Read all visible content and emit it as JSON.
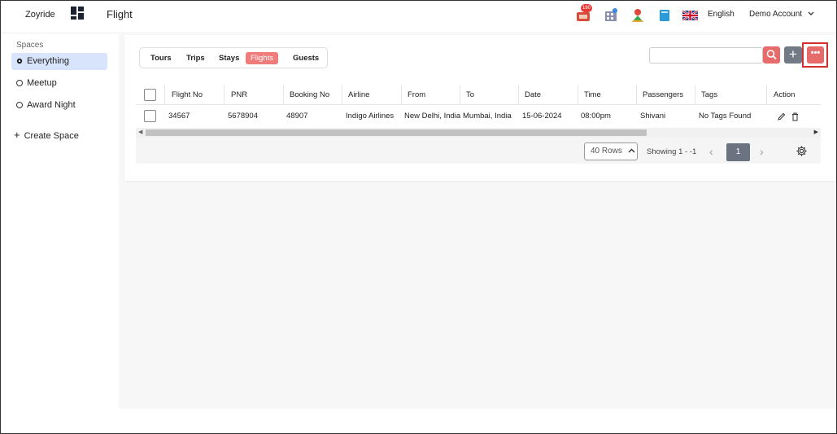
{
  "app": {
    "brand": "Zoyride",
    "page_title": "Flight"
  },
  "header": {
    "notification_count": "180",
    "language": "English",
    "account": "Demo Account",
    "icons": [
      "ticket-notification-icon",
      "building-icon",
      "map-pin-person-icon",
      "book-icon",
      "uk-flag-icon",
      "chevron-down-icon"
    ]
  },
  "sidebar": {
    "heading": "Spaces",
    "items": [
      {
        "label": "Everything",
        "active": true
      },
      {
        "label": "Meetup",
        "active": false
      },
      {
        "label": "Award Night",
        "active": false
      }
    ],
    "create_label": "Create Space"
  },
  "tabs": [
    {
      "label": "Tours",
      "active": false
    },
    {
      "label": "Trips",
      "active": false
    },
    {
      "label": "Stays",
      "active": false
    },
    {
      "label": "Flights",
      "active": true
    },
    {
      "label": "Guests",
      "active": false
    }
  ],
  "toolbar": {
    "search_value": "",
    "add_label": "+",
    "more_label": "•••"
  },
  "table": {
    "columns": [
      "Flight No",
      "PNR",
      "Booking No",
      "Airline",
      "From",
      "To",
      "Date",
      "Time",
      "Passengers",
      "Tags",
      "Action"
    ],
    "rows": [
      {
        "flight_no": "34567",
        "pnr": "5678904",
        "booking_no": "48907",
        "airline": "Indigo Airlines",
        "from": "New Delhi, India",
        "to": "Mumbai, India",
        "date": "15-06-2024",
        "time": "08:00pm",
        "passengers": "Shivani",
        "tags": "No Tags Found"
      }
    ]
  },
  "pagination": {
    "rows_label": "40 Rows",
    "showing": "Showing  1 - -1",
    "current_page": "1"
  },
  "colors": {
    "accent": "#e86b6b",
    "active_tab": "#ef7b7b",
    "secondary_button": "#727a86",
    "sidebar_active": "#d8e4fb",
    "highlight_border": "#d32f2f"
  }
}
